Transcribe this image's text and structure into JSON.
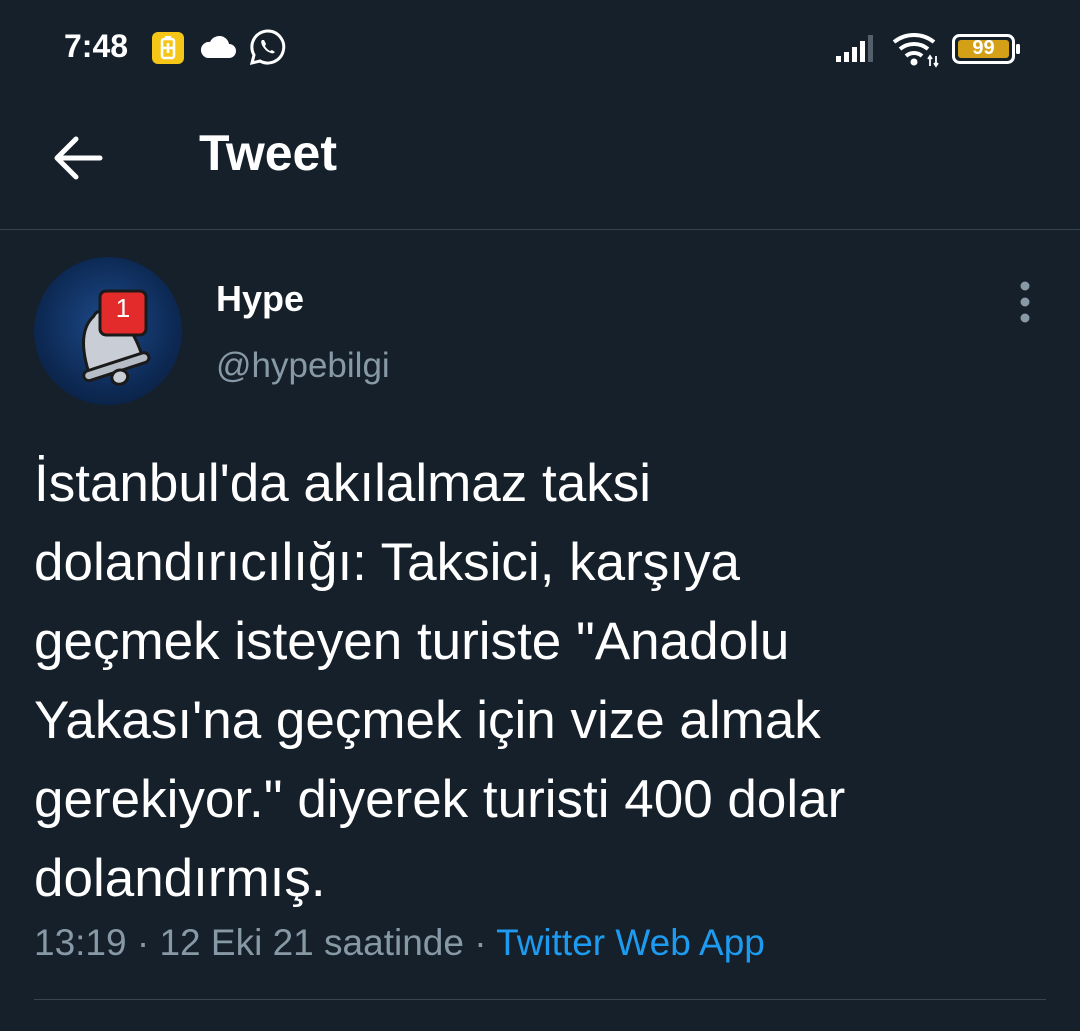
{
  "status_bar": {
    "time": "7:48",
    "left_icons": [
      "battery-saver-icon",
      "cloud-icon",
      "whatsapp-icon"
    ],
    "right_icons": [
      "signal-icon",
      "wifi-icon",
      "battery-icon"
    ],
    "battery_level": "99",
    "colors": {
      "battery_fill": "#d4a017",
      "saver_badge": "#f5c518"
    }
  },
  "header": {
    "back_icon": "arrow-left-icon",
    "title": "Tweet"
  },
  "tweet": {
    "author": {
      "name": "Hype",
      "handle": "@hypebilgi",
      "avatar_icon": "notification-bell-icon",
      "avatar_badge": "1"
    },
    "more_icon": "more-vertical-icon",
    "text": "İstanbul'da akılalmaz taksi\ndolandırıcılığı: Taksici, karşıya\ngeçmek isteyen turiste \"Anadolu\nYakası'na geçmek için vize almak\ngerekiyor.\" diyerek turisti 400 dolar\ndolandırmış.",
    "time": "13:19",
    "date": "12 Eki 21 saatinde",
    "separator": "·",
    "source": "Twitter Web App"
  },
  "colors": {
    "background": "#15202b",
    "secondary_text": "#8899a6",
    "accent": "#1d9bf0",
    "divider": "#38444d"
  }
}
